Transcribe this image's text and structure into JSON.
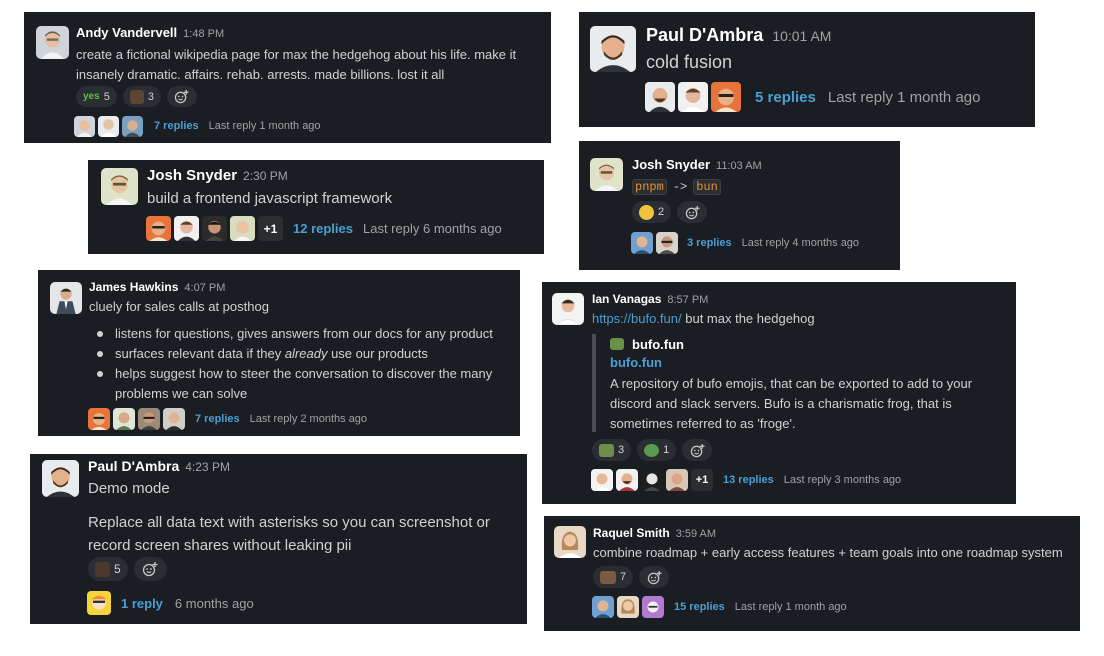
{
  "colors": {
    "card_bg": "#1a1d21",
    "link": "#4a9fd5",
    "muted": "#a0a2a5",
    "reaction_bg": "#2a2d31"
  },
  "andy": {
    "name": "Andy Vandervell",
    "time": "1:48 PM",
    "line1": "create a fictional wikipedia page for max the hedgehog about his life. make it",
    "line2": "insanely dramatic. affairs. rehab. arrests. made billions. lost it all",
    "r1_label": "yes",
    "r1_count": "5",
    "r2_count": "3",
    "replies": "7 replies",
    "last": "Last reply 1 month ago"
  },
  "paul1": {
    "name": "Paul D'Ambra",
    "time": "10:01 AM",
    "text": "cold fusion",
    "replies": "5 replies",
    "last": "Last reply 1 month ago"
  },
  "josh1": {
    "name": "Josh Snyder",
    "time": "2:30 PM",
    "text": "build a frontend javascript framework",
    "more": "+1",
    "replies": "12 replies",
    "last": "Last reply 6 months ago"
  },
  "josh2": {
    "name": "Josh Snyder",
    "time": "11:03 AM",
    "code1": "pnpm",
    "arrow": "->",
    "code2": "bun",
    "r1_count": "2",
    "replies": "3 replies",
    "last": "Last reply 4 months ago"
  },
  "james": {
    "name": "James Hawkins",
    "time": "4:07 PM",
    "text": "cluely for sales calls at posthog",
    "b1": "listens for questions, gives answers from our docs for any product",
    "b2_pre": "surfaces relevant data if they ",
    "b2_em": "already",
    "b2_post": " use our products",
    "b3_l1": "helps suggest how to steer the conversation to discover the many",
    "b3_l2": "problems we can solve",
    "replies": "7 replies",
    "last": "Last reply 2 months ago"
  },
  "ian": {
    "name": "Ian Vanagas",
    "time": "8:57 PM",
    "link": "https://bufo.fun/",
    "text_after": " but max the hedgehog",
    "unfurl_site": "bufo.fun",
    "unfurl_title": "bufo.fun",
    "unfurl_l1": "A repository of bufo emojis, that can be exported to add to your",
    "unfurl_l2": "discord and slack servers. Bufo is a charismatic frog, that is",
    "unfurl_l3": "sometimes referred to as 'froge'.",
    "r1_count": "3",
    "r2_count": "1",
    "more": "+1",
    "replies": "13 replies",
    "last": "Last reply 3 months ago"
  },
  "paul2": {
    "name": "Paul D'Ambra",
    "time": "4:23 PM",
    "line1": "Demo mode",
    "line2": "Replace all data text with asterisks so you can screenshot or",
    "line3": "record screen shares without leaking pii",
    "r1_count": "5",
    "replies": "1 reply",
    "last": "6 months ago"
  },
  "raquel": {
    "name": "Raquel Smith",
    "time": "3:59 AM",
    "text": "combine roadmap + early access features + team goals into one roadmap system",
    "r1_count": "7",
    "replies": "15 replies",
    "last": "Last reply 1 month ago"
  }
}
